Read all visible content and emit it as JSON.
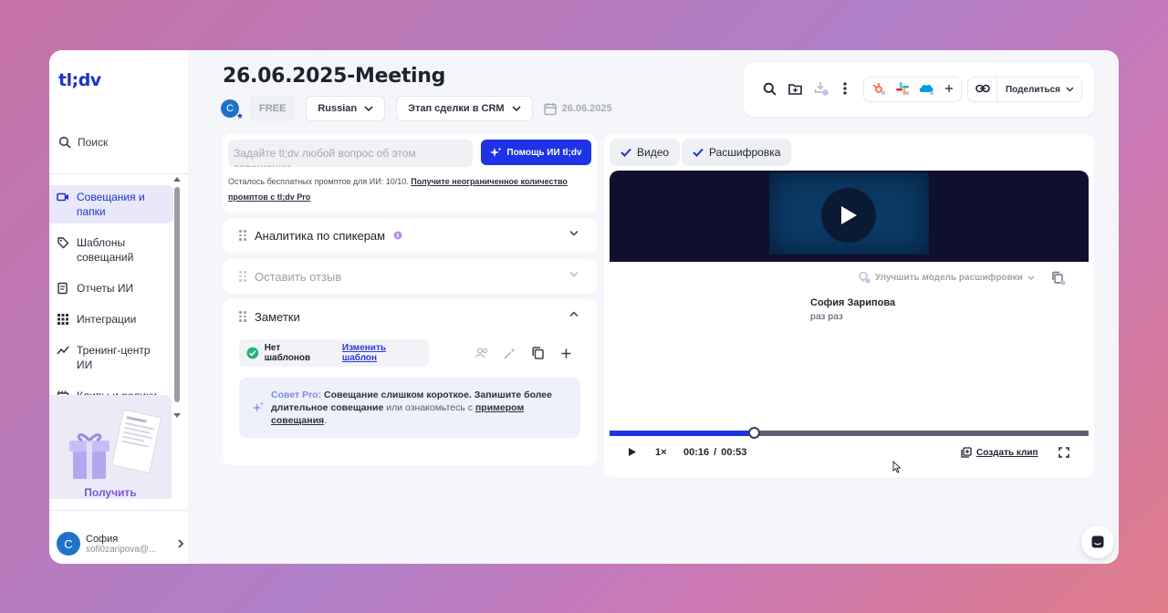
{
  "app": {
    "logo": "tl;dv"
  },
  "sidebar": {
    "search_label": "Поиск",
    "items": [
      {
        "label": "Совещания и папки",
        "icon": "video-icon",
        "active": true
      },
      {
        "label": "Шаблоны совещаний",
        "icon": "tag-icon"
      },
      {
        "label": "Отчеты ИИ",
        "icon": "report-icon"
      },
      {
        "label": "Интеграции",
        "icon": "grid-icon"
      },
      {
        "label": "Тренинг-центр ИИ",
        "icon": "chart-icon"
      },
      {
        "label": "Клипы и ролики",
        "icon": "clapper-icon"
      }
    ],
    "promo_label": "Получить",
    "user": {
      "initial": "C",
      "name": "София",
      "email": "sofi0zaripova@..."
    }
  },
  "meeting": {
    "title": "26.06.2025-Meeting",
    "owner_initial": "C",
    "plan_badge": "FREE",
    "language": "Russian",
    "crm_stage": "Этап сделки в CRM",
    "date": "26.06.2025"
  },
  "toolbar": {
    "share_label": "Поделиться"
  },
  "ask": {
    "placeholder": "Задайте tl;dv любой вопрос об этом совещании",
    "button": "Помощь ИИ tl;dv",
    "note": "Осталось бесплатных промптов для ИИ: 10/10.",
    "note_link": "Получите неограниченное количество промптов с tl;dv Pro"
  },
  "sections": {
    "speakers": "Аналитика по спикерам",
    "feedback": "Оставить отзыв",
    "notes": "Заметки"
  },
  "notes": {
    "template_status": "Нет шаблонов",
    "change_template": "Изменить шаблон",
    "tip_prefix": "Совет Pro:",
    "tip_bold": "Совещание слишком короткое. Запишите более длительное совещание",
    "tip_mid": "или ознакомьтесь с",
    "tip_link": "примером совещания",
    "tip_end": "."
  },
  "tabs": {
    "video": "Видео",
    "transcript": "Расшифровка"
  },
  "transcript": {
    "improve": "Улучшить модель расшифровки",
    "speaker": "София Зарипова",
    "text": "раз раз"
  },
  "player": {
    "speed": "1×",
    "current": "00:16",
    "duration": "00:53",
    "progress": 0.3,
    "create_clip": "Создать клип"
  },
  "colors": {
    "accent": "#1e32e6",
    "brand": "#1e32c8"
  }
}
